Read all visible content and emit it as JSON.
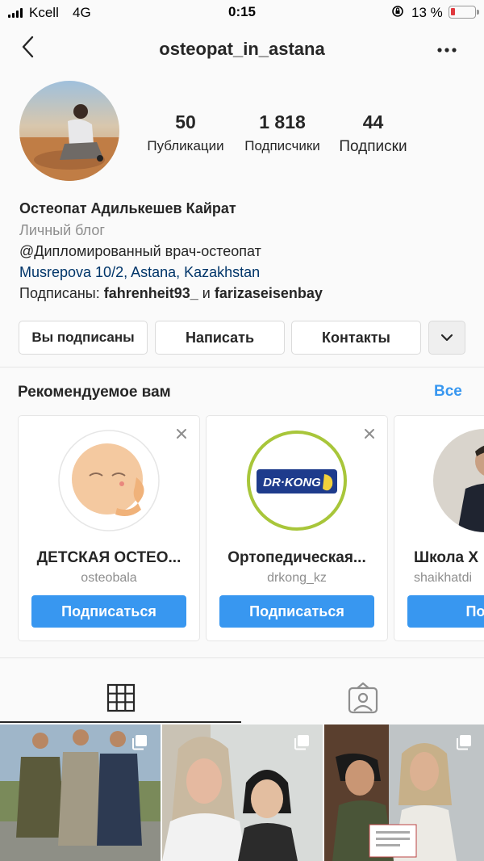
{
  "status_bar": {
    "carrier": "Kcell",
    "network": "4G",
    "time": "0:15",
    "battery": "13 %"
  },
  "header": {
    "title": "osteopat_in_astana"
  },
  "profile": {
    "stats": [
      {
        "value": "50",
        "label": "Публикации"
      },
      {
        "value": "1 818",
        "label": "Подписчики"
      },
      {
        "value": "44",
        "label": "Подписки"
      }
    ],
    "name": "Остеопат Адилькешев Кайрат",
    "category": "Личный блог",
    "bio": "@Дипломированный врач-остеопат",
    "location": "Musrepova 10/2, Astana, Kazakhstan",
    "followed_by_prefix": "Подписаны: ",
    "followed_by_user1": "fahrenheit93_",
    "followed_by_and": " и ",
    "followed_by_user2": "farizaseisenbay"
  },
  "actions": {
    "following": "Вы подписаны",
    "message": "Написать",
    "contacts": "Контакты"
  },
  "suggestions": {
    "title": "Рекомендуемое вам",
    "see_all": "Все",
    "cards": [
      {
        "name": "ДЕТСКАЯ ОСТЕО...",
        "username": "osteobala",
        "button": "Подписаться"
      },
      {
        "name": "Ортопедическая...",
        "username": "drkong_kz",
        "button": "Подписаться",
        "logo_text": "DR·KONG"
      },
      {
        "name": "Школа Х",
        "username": "shaikhatdi",
        "button": "Подпи"
      }
    ]
  },
  "colors": {
    "accent": "#3897f0",
    "text": "#262626",
    "muted": "#8e8e8e",
    "link": "#003569"
  }
}
